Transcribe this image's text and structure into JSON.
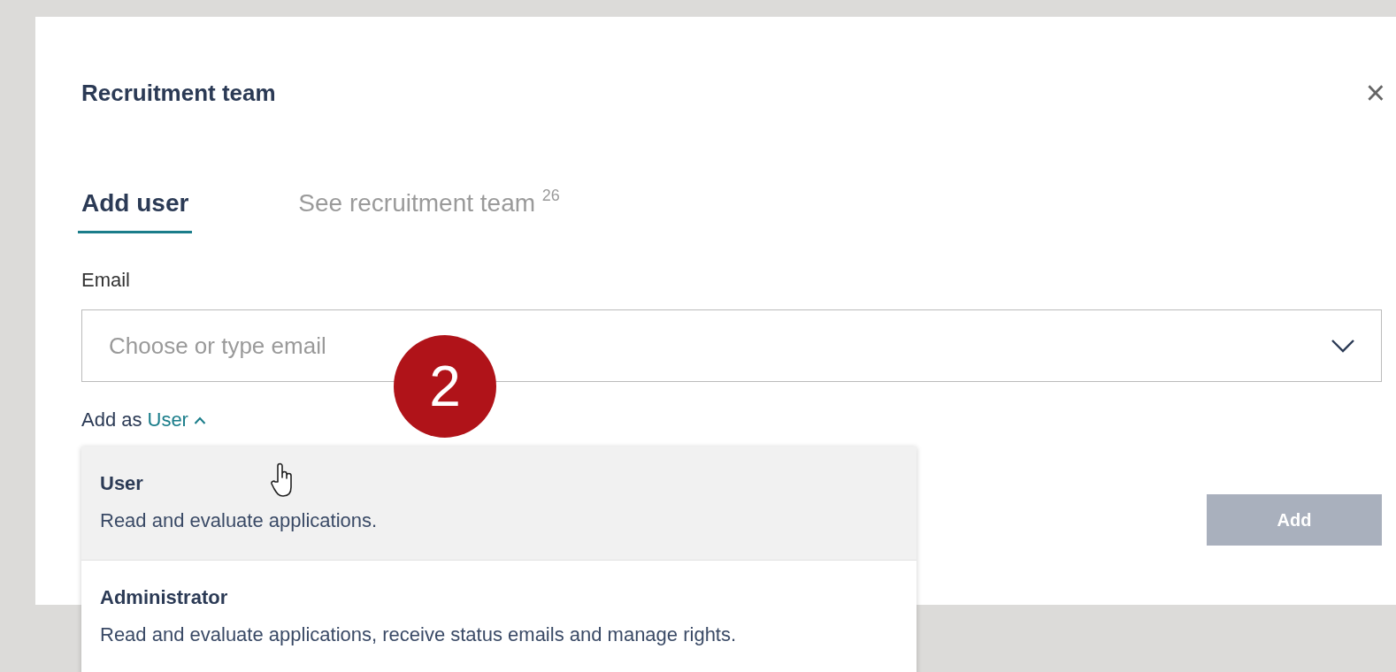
{
  "dialog": {
    "title": "Recruitment team",
    "close": "×"
  },
  "tabs": [
    {
      "label": "Add user",
      "selected": true
    },
    {
      "label": "See recruitment team",
      "count": "26",
      "selected": false
    }
  ],
  "email": {
    "label": "Email",
    "placeholder": "Choose or type email"
  },
  "role": {
    "prefix": "Add as",
    "value": "User",
    "expanded": true
  },
  "role_menu": [
    {
      "title": "User",
      "description": "Read and evaluate applications.",
      "selected": true
    },
    {
      "title": "Administrator",
      "description": "Read and evaluate applications, receive status emails and manage rights.",
      "selected": false
    }
  ],
  "add_button": {
    "label": "Add",
    "disabled": true
  },
  "step_badge": "2"
}
